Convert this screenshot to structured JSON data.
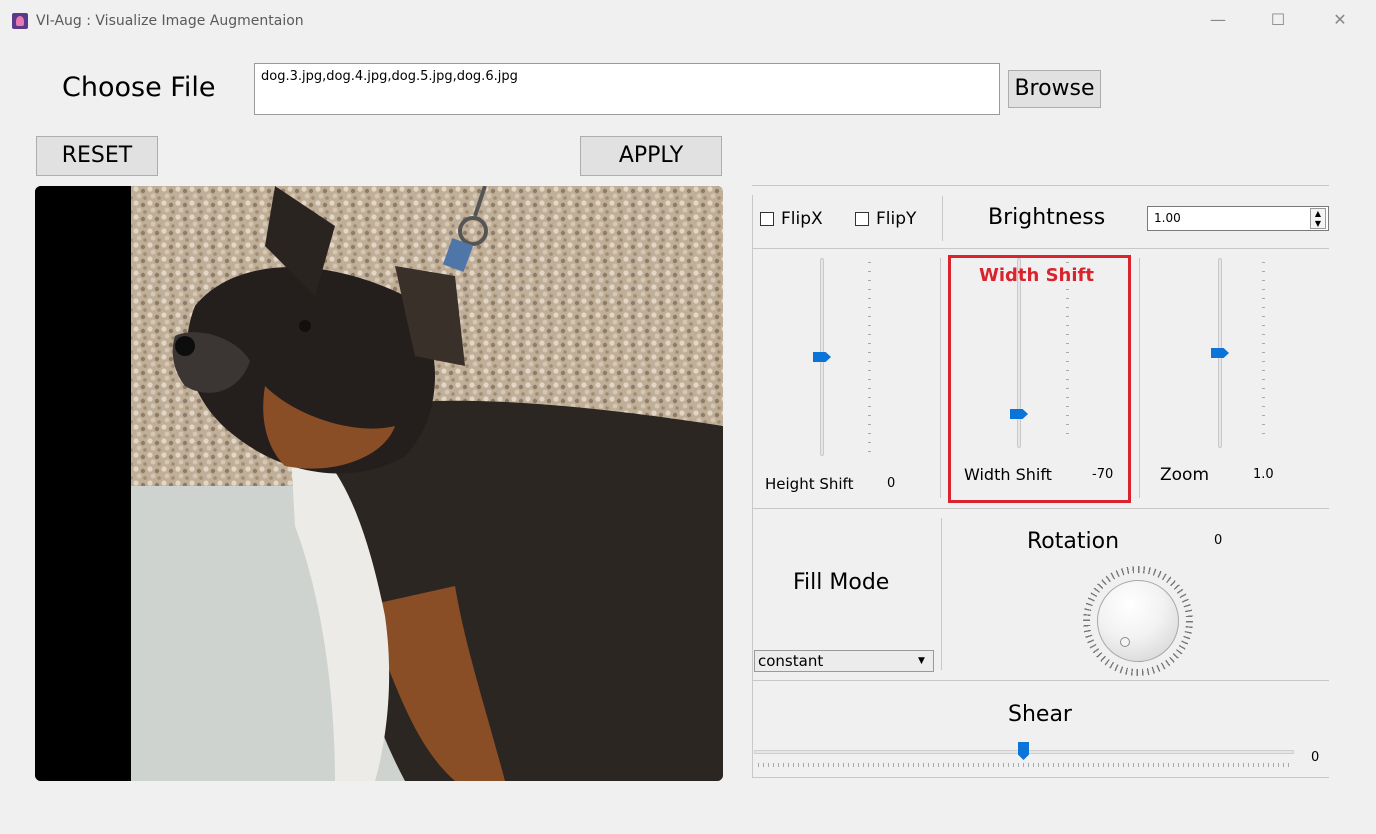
{
  "window": {
    "title": "VI-Aug : Visualize Image Augmentaion",
    "minimize_glyph": "—",
    "maximize_glyph": "☐",
    "close_glyph": "✕"
  },
  "file": {
    "label": "Choose File",
    "value": "dog.3.jpg,dog.4.jpg,dog.5.jpg,dog.6.jpg",
    "browse_label": "Browse"
  },
  "actions": {
    "reset_label": "RESET",
    "apply_label": "APPLY"
  },
  "controls": {
    "flipx_label": "FlipX",
    "flipx_checked": false,
    "flipy_label": "FlipY",
    "flipy_checked": false,
    "brightness_label": "Brightness",
    "brightness_value": "1.00",
    "height_shift": {
      "label": "Height Shift",
      "value": "0"
    },
    "width_shift": {
      "label": "Width Shift",
      "value": "-70",
      "highlight_label": "Width Shift"
    },
    "zoom": {
      "label": "Zoom",
      "value": "1.0"
    },
    "fill_mode": {
      "label": "Fill Mode",
      "selected": "constant"
    },
    "rotation": {
      "label": "Rotation",
      "value": "0"
    },
    "shear": {
      "label": "Shear",
      "value": "0"
    }
  },
  "colors": {
    "accent": "#0a74d9",
    "highlight": "#d9232d"
  }
}
